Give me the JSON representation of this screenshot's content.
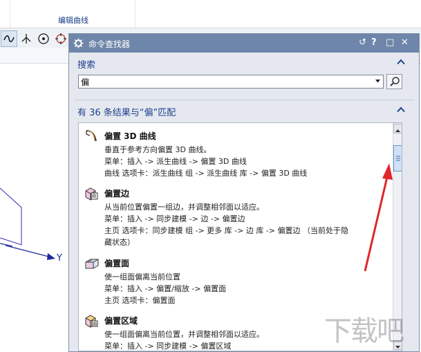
{
  "ribbon": {
    "group_label": "编辑曲线"
  },
  "viewport": {
    "axis_label": "Y"
  },
  "dialog": {
    "title": "命令查找器",
    "title_buttons": {
      "reset": "↺",
      "help": "?",
      "maximize": "□",
      "close": "✕"
    },
    "search_section_label": "搜索",
    "search_value": "偏",
    "results_summary": "有 36 条结果与“偏”匹配",
    "results": [
      {
        "name": "偏置 3D 曲线",
        "icon": "offset-3d-curve-icon",
        "lines": [
          "垂直于参考方向偏置 3D 曲线。",
          "菜单：插入 -> 派生曲线 -> 偏置 3D 曲线",
          "曲线 选项卡：派生曲线 组 -> 派生曲线 库 -> 偏置 3D 曲线"
        ]
      },
      {
        "name": "偏置边",
        "icon": "offset-edge-icon",
        "lines": [
          "从当前位置偏置一组边，并调整相邻面以适应。",
          "菜单：插入 -> 同步建模 -> 边 -> 偏置边",
          "主页 选项卡：同步建模 组 -> 更多 库 -> 边 库 -> 偏置边 （当前处于隐",
          "藏状态）"
        ]
      },
      {
        "name": "偏置面",
        "icon": "offset-face-icon",
        "lines": [
          "使一组面偏离当前位置",
          "菜单：插入 -> 偏置/缩放 -> 偏置面",
          "主页 选项卡：偏置面"
        ]
      },
      {
        "name": "偏置区域",
        "icon": "offset-region-icon",
        "lines": [
          "使一组面偏离当前位置，并调整相邻面以适应。",
          "菜单：插入 -> 同步建模 -> 偏置区域"
        ]
      }
    ]
  },
  "watermark": "下载吧",
  "colors": {
    "title_bar": "#6e86a9",
    "section_text": "#1f3f8f",
    "annotation_arrow": "#e0262b",
    "axis_line": "#1b2b9a"
  }
}
